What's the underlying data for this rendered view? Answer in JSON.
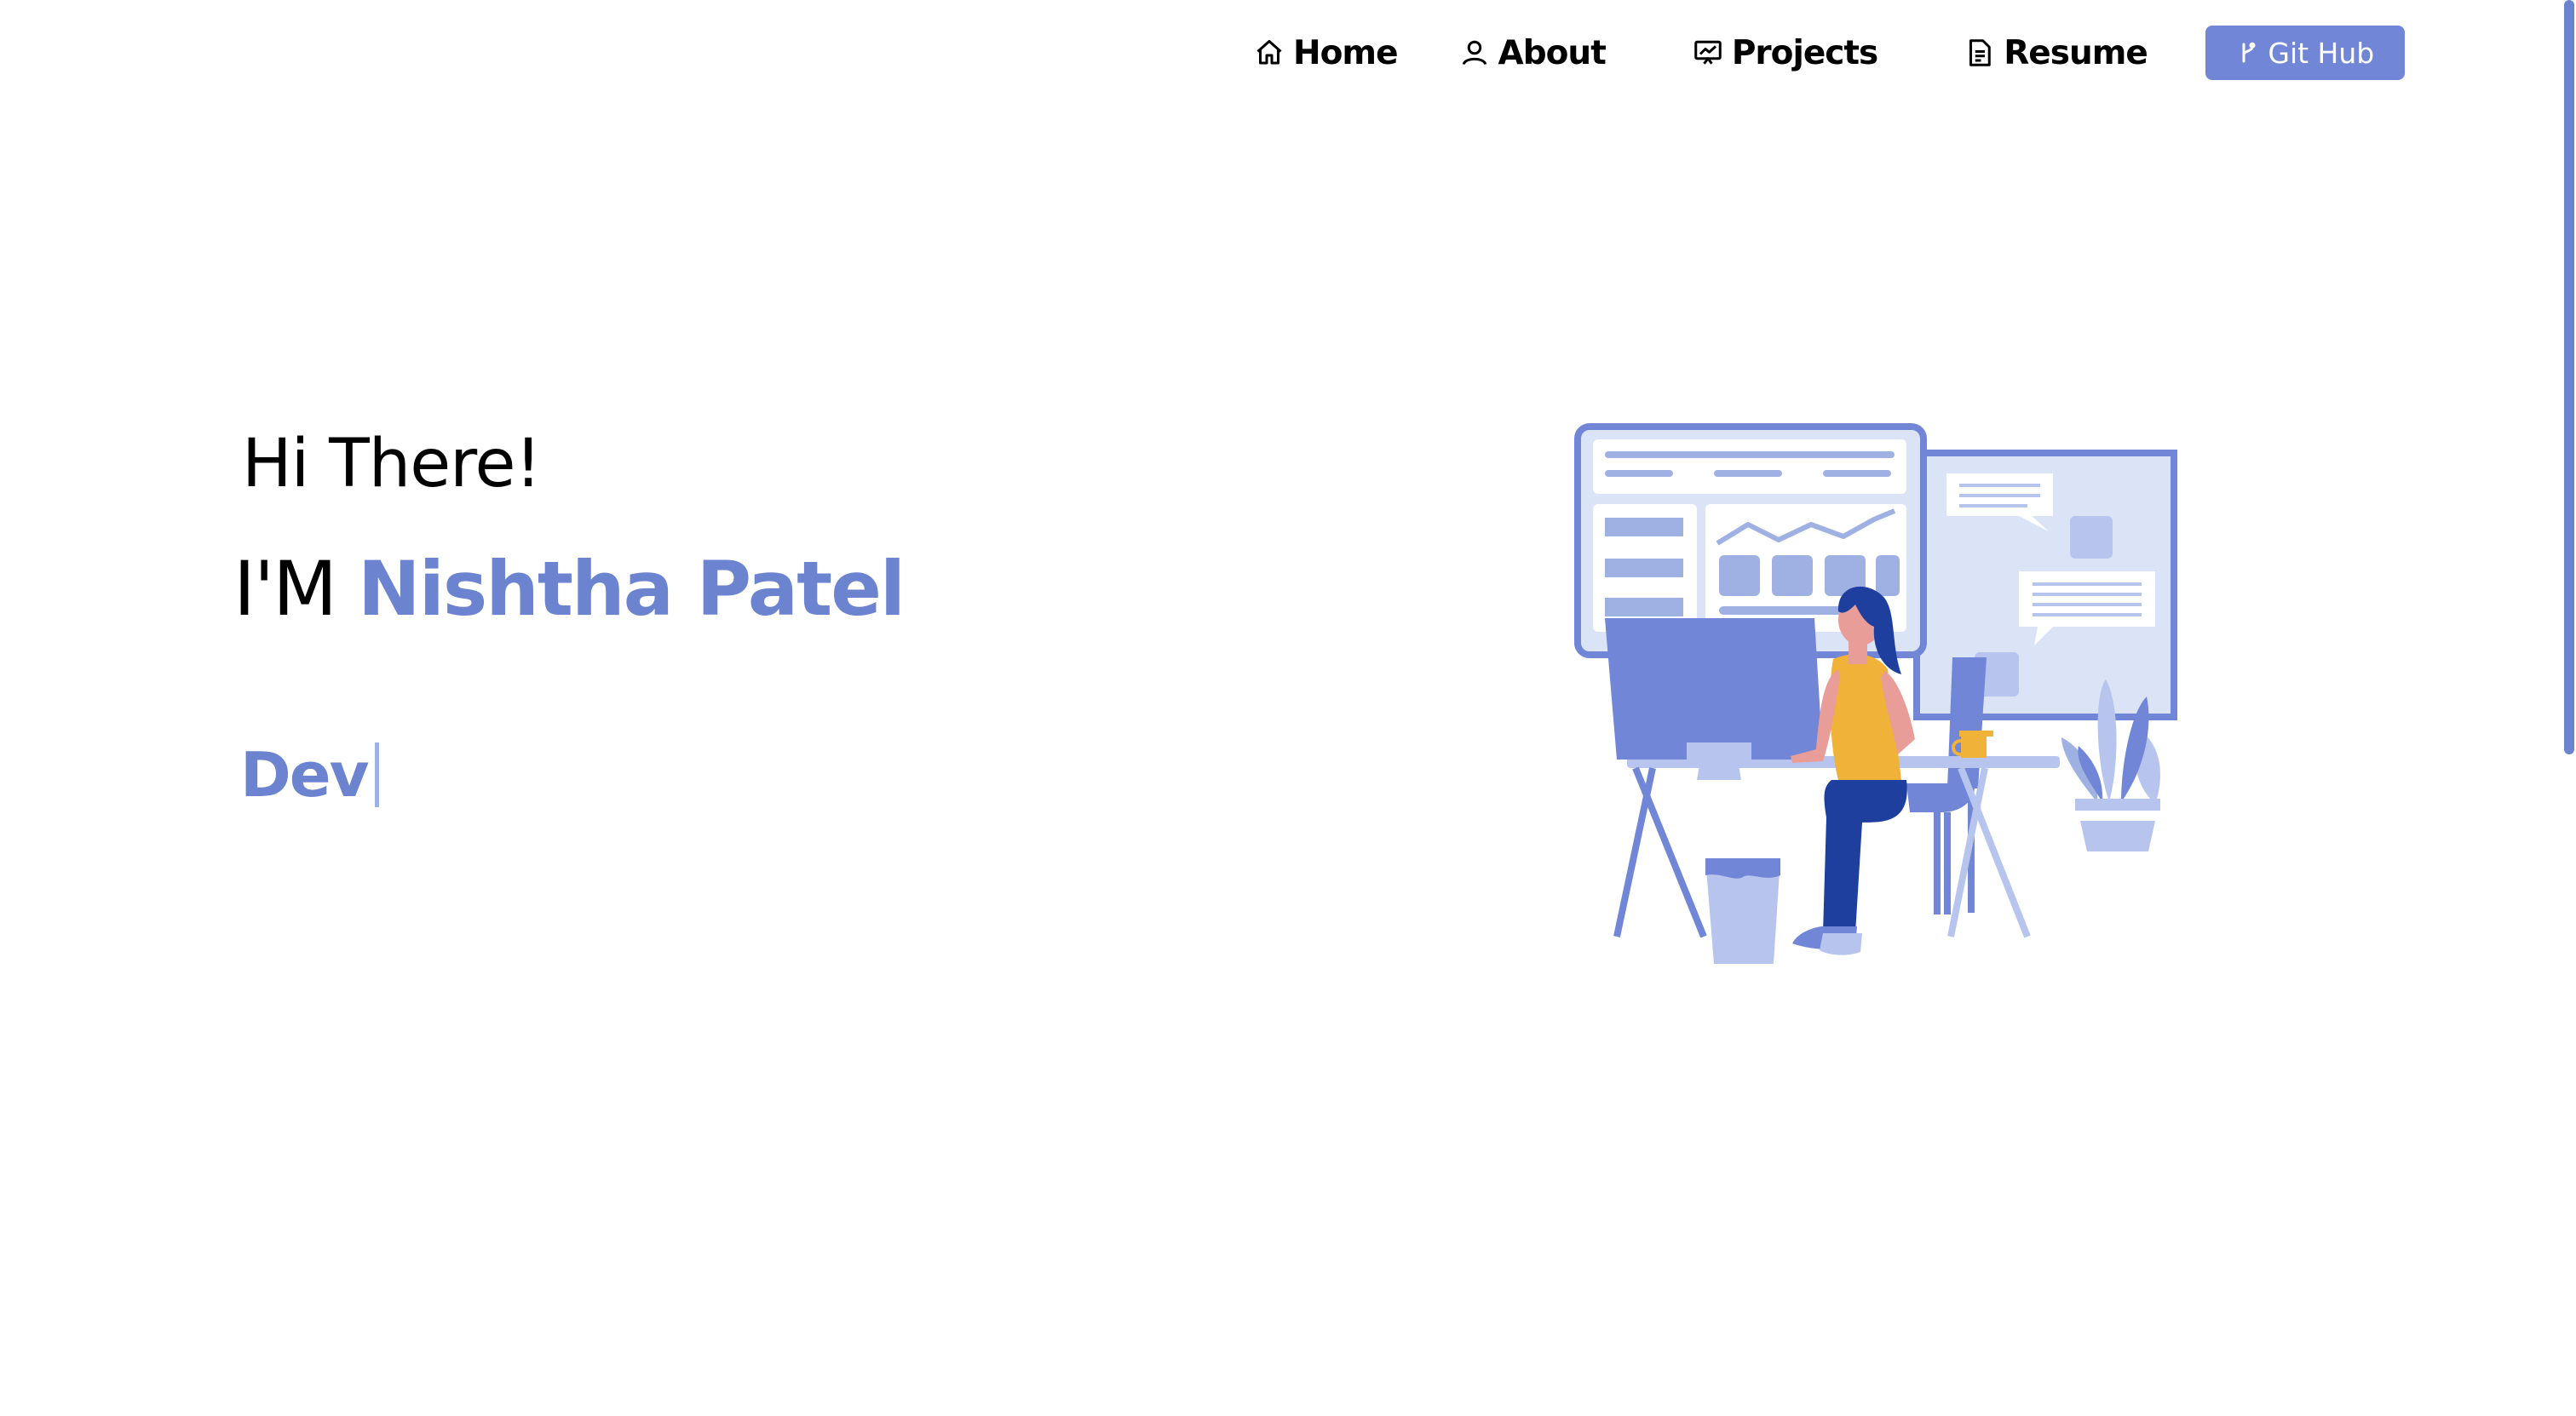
{
  "nav": {
    "items": [
      {
        "label": "Home",
        "icon": "home-icon"
      },
      {
        "label": "About",
        "icon": "user-icon"
      },
      {
        "label": "Projects",
        "icon": "presentation-chart-icon"
      },
      {
        "label": "Resume",
        "icon": "document-icon"
      }
    ],
    "github": {
      "label": "Git Hub",
      "icon": "git-fork-icon"
    }
  },
  "hero": {
    "greeting": "Hi There!",
    "intro_prefix": "I'M ",
    "name": "Nishtha Patel",
    "typed_text": "Dev"
  },
  "colors": {
    "accent": "#6c83d0",
    "button": "#7186d6",
    "text": "#000000",
    "background": "#ffffff"
  }
}
